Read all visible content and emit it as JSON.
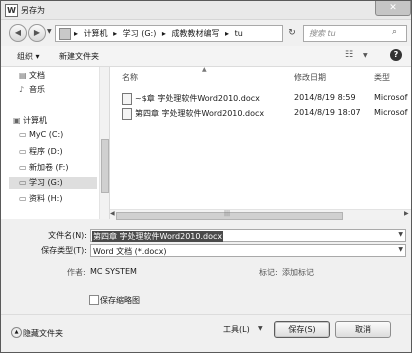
{
  "window": {
    "title": "另存为",
    "app_icon": "W",
    "close_glyph": "✕"
  },
  "address": {
    "crumbs": [
      "计算机",
      "学习 (G:)",
      "成教教材编写",
      "tu"
    ],
    "separator": "▸"
  },
  "search": {
    "placeholder": "搜索 tu"
  },
  "toolbar": {
    "organize": "组织 ▾",
    "new_folder": "新建文件夹",
    "help": "?"
  },
  "nav": {
    "items": [
      {
        "label": "文档",
        "icon": "document-icon"
      },
      {
        "label": "音乐",
        "icon": "music-icon"
      },
      {
        "label": "计算机",
        "icon": "computer-icon"
      },
      {
        "label": "MyC (C:)",
        "icon": "drive-icon"
      },
      {
        "label": "程序 (D:)",
        "icon": "drive-icon"
      },
      {
        "label": "新加卷 (F:)",
        "icon": "drive-icon"
      },
      {
        "label": "学习 (G:)",
        "icon": "drive-icon",
        "selected": true
      },
      {
        "label": "资料 (H:)",
        "icon": "drive-icon"
      }
    ]
  },
  "columns": {
    "name": "名称",
    "date": "修改日期",
    "type": "类型"
  },
  "files": [
    {
      "name": "~$章 字处理软件Word2010.docx",
      "date": "2014/8/19 8:59",
      "type": "Microsof"
    },
    {
      "name": "第四章 字处理软件Word2010.docx",
      "date": "2014/8/19 18:07",
      "type": "Microsof"
    }
  ],
  "form": {
    "filename_label": "文件名(N):",
    "filename_value": "第四章 字处理软件Word2010.docx",
    "filetype_label": "保存类型(T):",
    "filetype_value": "Word 文档 (*.docx)",
    "author_label": "作者:",
    "author_value": "MC SYSTEM",
    "tags_label": "标记:",
    "tags_value": "添加标记",
    "thumbnail_label": "保存缩略图"
  },
  "footer": {
    "hide_folders": "隐藏文件夹",
    "tools": "工具(L)",
    "save": "保存(S)",
    "cancel": "取消"
  }
}
